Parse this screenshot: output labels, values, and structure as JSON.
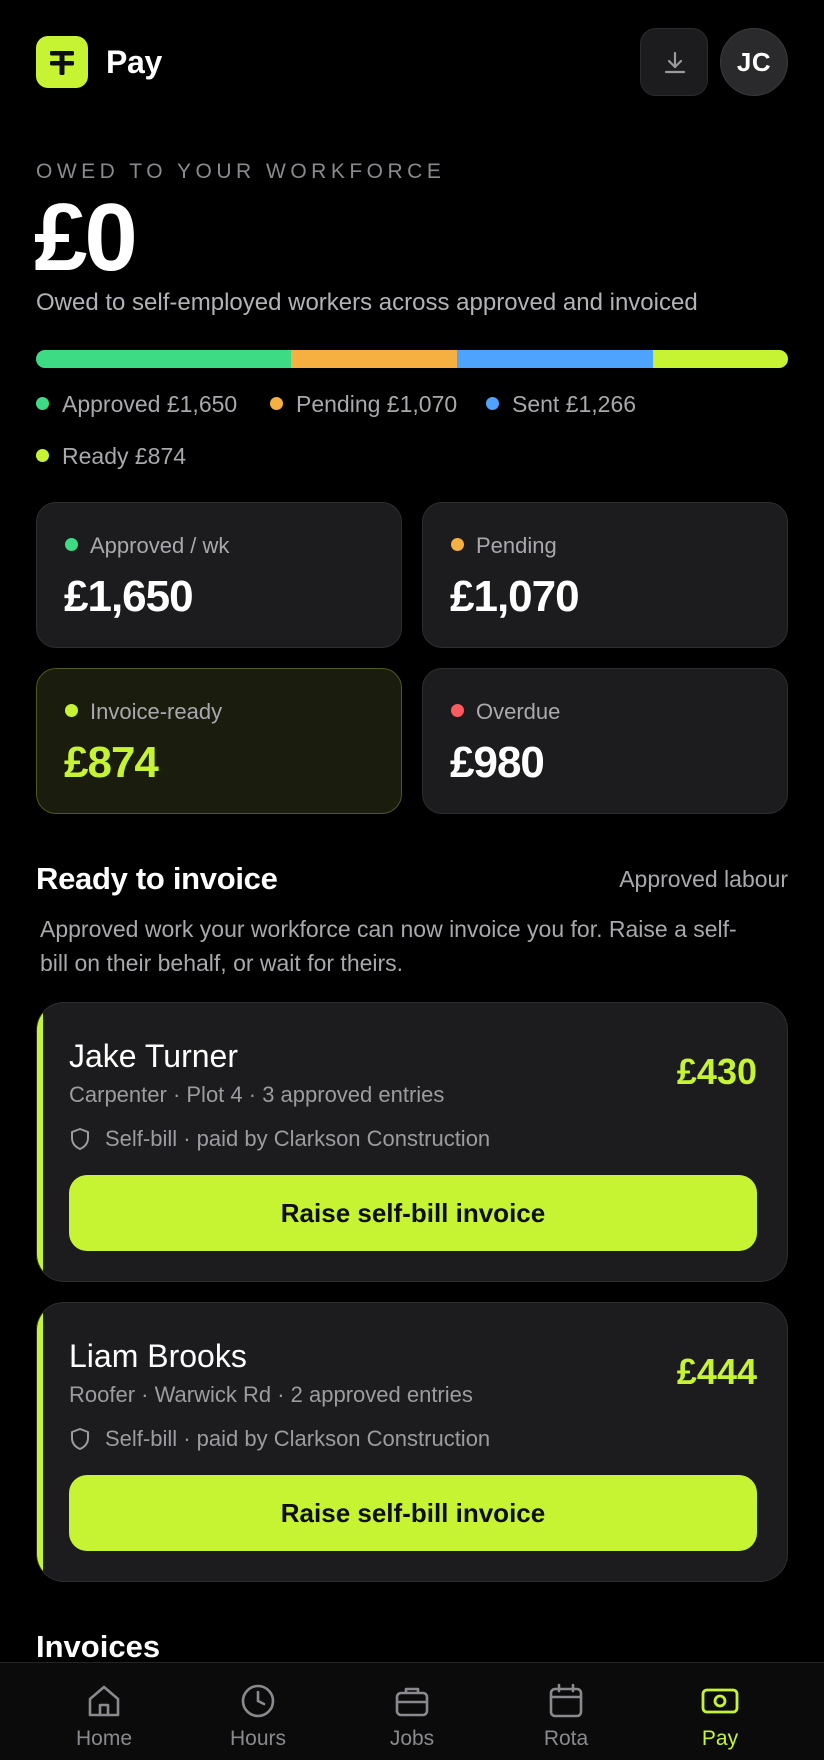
{
  "header": {
    "app_title": "Pay",
    "logo_icon": "pay-logo-icon",
    "download_icon": "download-icon",
    "avatar_initials": "JC"
  },
  "summary": {
    "eyebrow": "OWED TO YOUR WORKFORCE",
    "total": "£0",
    "subtitle": "Owed to self-employed workers across approved and invoiced",
    "breakdown": [
      {
        "label": "Approved £1,650",
        "value": 1650,
        "color": "#3ddc84"
      },
      {
        "label": "Pending £1,070",
        "value": 1070,
        "color": "#f5b041"
      },
      {
        "label": "Sent £1,266",
        "value": 1266,
        "color": "#4da3ff"
      },
      {
        "label": "Ready £874",
        "value": 874,
        "color": "#c6f432"
      }
    ]
  },
  "stats": [
    {
      "label": "Approved / wk",
      "value": "£1,650",
      "dot_color": "#3ddc84",
      "value_color": "#ffffff"
    },
    {
      "label": "Pending",
      "value": "£1,070",
      "dot_color": "#f5b041",
      "value_color": "#ffffff"
    },
    {
      "label": "Invoice-ready",
      "value": "£874",
      "dot_color": "#c6f432",
      "value_color": "#c6f432"
    },
    {
      "label": "Overdue",
      "value": "£980",
      "dot_color": "#ff5a5f",
      "value_color": "#ffffff"
    }
  ],
  "ready_section": {
    "title": "Ready to invoice",
    "link": "Approved labour",
    "description": "Approved work your workforce can now invoice you for. Raise a self-bill on their behalf, or wait for theirs."
  },
  "workers": [
    {
      "name": "Jake Turner",
      "meta": "Carpenter · Plot 4 · 3 approved entries",
      "amount": "£430",
      "selfbill": "Self-bill · paid by Clarkson Construction",
      "button": "Raise self-bill invoice"
    },
    {
      "name": "Liam Brooks",
      "meta": "Roofer · Warwick Rd · 2 approved entries",
      "amount": "£444",
      "selfbill": "Self-bill · paid by Clarkson Construction",
      "button": "Raise self-bill invoice"
    }
  ],
  "invoices_section": {
    "title": "Invoices"
  },
  "tabs": [
    {
      "label": "Home",
      "icon": "home-icon",
      "active": false
    },
    {
      "label": "Hours",
      "icon": "clock-icon",
      "active": false
    },
    {
      "label": "Jobs",
      "icon": "briefcase-icon",
      "active": false
    },
    {
      "label": "Rota",
      "icon": "calendar-icon",
      "active": false
    },
    {
      "label": "Pay",
      "icon": "pay-icon",
      "active": true
    }
  ],
  "colors": {
    "accent": "#c6f432",
    "background": "#000000",
    "card": "#1c1c1e",
    "overdue": "#ff5a5f"
  }
}
